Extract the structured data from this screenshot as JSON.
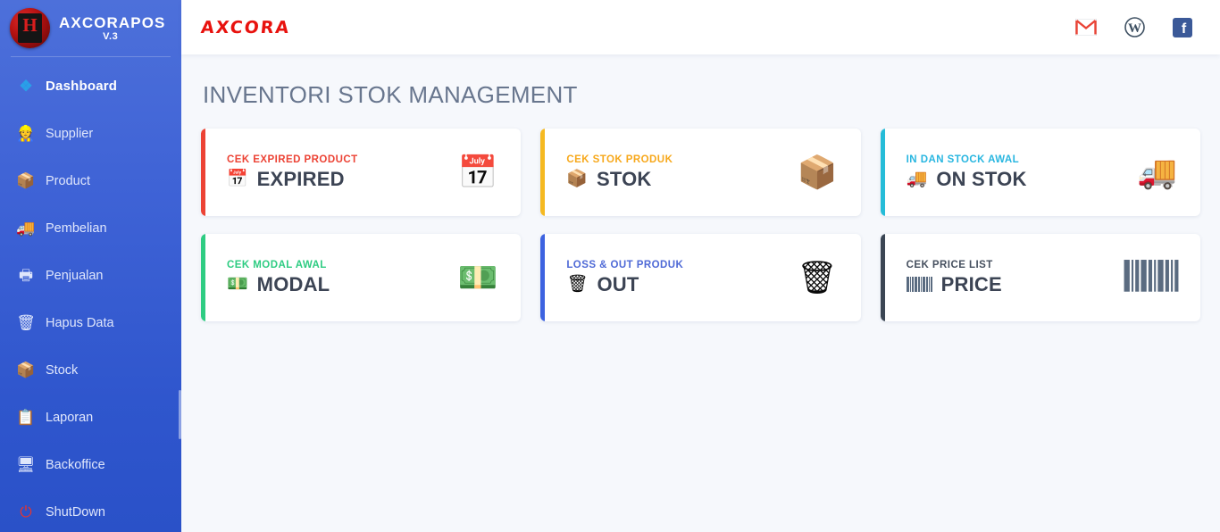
{
  "sidebar": {
    "brand": {
      "title": "AXCORAPOS",
      "version": "V.3",
      "logo_icon": "axcora-badge-icon"
    },
    "items": [
      {
        "label": "Dashboard",
        "icon": "windows-icon",
        "glyph": "❖",
        "active": true
      },
      {
        "label": "Supplier",
        "icon": "supplier-person-icon",
        "glyph": "👷",
        "active": false
      },
      {
        "label": "Product",
        "icon": "box-icon",
        "glyph": "📦",
        "active": false
      },
      {
        "label": "Pembelian",
        "icon": "delivery-truck-icon",
        "glyph": "🚚",
        "active": false
      },
      {
        "label": "Penjualan",
        "icon": "cash-register-icon",
        "glyph": "🖶",
        "active": false
      },
      {
        "label": "Hapus Data",
        "icon": "trash-icon",
        "glyph": "🗑",
        "active": false
      },
      {
        "label": "Stock",
        "icon": "stock-box-icon",
        "glyph": "📦",
        "active": false
      },
      {
        "label": "Laporan",
        "icon": "report-clipboard-icon",
        "glyph": "📋",
        "active": false
      },
      {
        "label": "Backoffice",
        "icon": "monitor-icon",
        "glyph": "🖥",
        "active": false
      },
      {
        "label": "ShutDown",
        "icon": "power-icon",
        "glyph": "⏻",
        "active": false
      }
    ]
  },
  "topbar": {
    "logo_text": "AXCORA",
    "icons": [
      {
        "name": "gmail-icon",
        "label": "Gmail"
      },
      {
        "name": "wordpress-icon",
        "label": "WordPress"
      },
      {
        "name": "facebook-icon",
        "label": "Facebook"
      }
    ]
  },
  "page": {
    "title": "INVENTORI STOK MANAGEMENT"
  },
  "cards": [
    {
      "kicker": "CEK EXPIRED PRODUCT",
      "title": "EXPIRED",
      "icon": "calendar-icon",
      "glyph": "📅",
      "accent_color": "#ec4335",
      "kicker_color": "#ec4335"
    },
    {
      "kicker": "CEK STOK PRODUK",
      "title": "STOK",
      "icon": "box-icon",
      "glyph": "📦",
      "accent_color": "#f5b921",
      "kicker_color": "#f7a81b"
    },
    {
      "kicker": "IN DAN STOCK AWAL",
      "title": "ON STOK",
      "icon": "delivery-truck-icon",
      "glyph": "🚚",
      "accent_color": "#25bcd8",
      "kicker_color": "#28b6e0"
    },
    {
      "kicker": "CEK MODAL AWAL",
      "title": "MODAL",
      "icon": "money-man-icon",
      "glyph": "💵",
      "accent_color": "#2ecc82",
      "kicker_color": "#2ecc82"
    },
    {
      "kicker": "LOSS & OUT PRODUK",
      "title": "OUT",
      "icon": "trash-icon",
      "glyph": "🗑",
      "accent_color": "#3d63e0",
      "kicker_color": "#4e69d6"
    },
    {
      "kicker": "CEK PRICE LIST",
      "title": "PRICE",
      "icon": "barcode-icon",
      "glyph": "barcode",
      "accent_color": "#3b4654",
      "kicker_color": "#46505f"
    }
  ]
}
